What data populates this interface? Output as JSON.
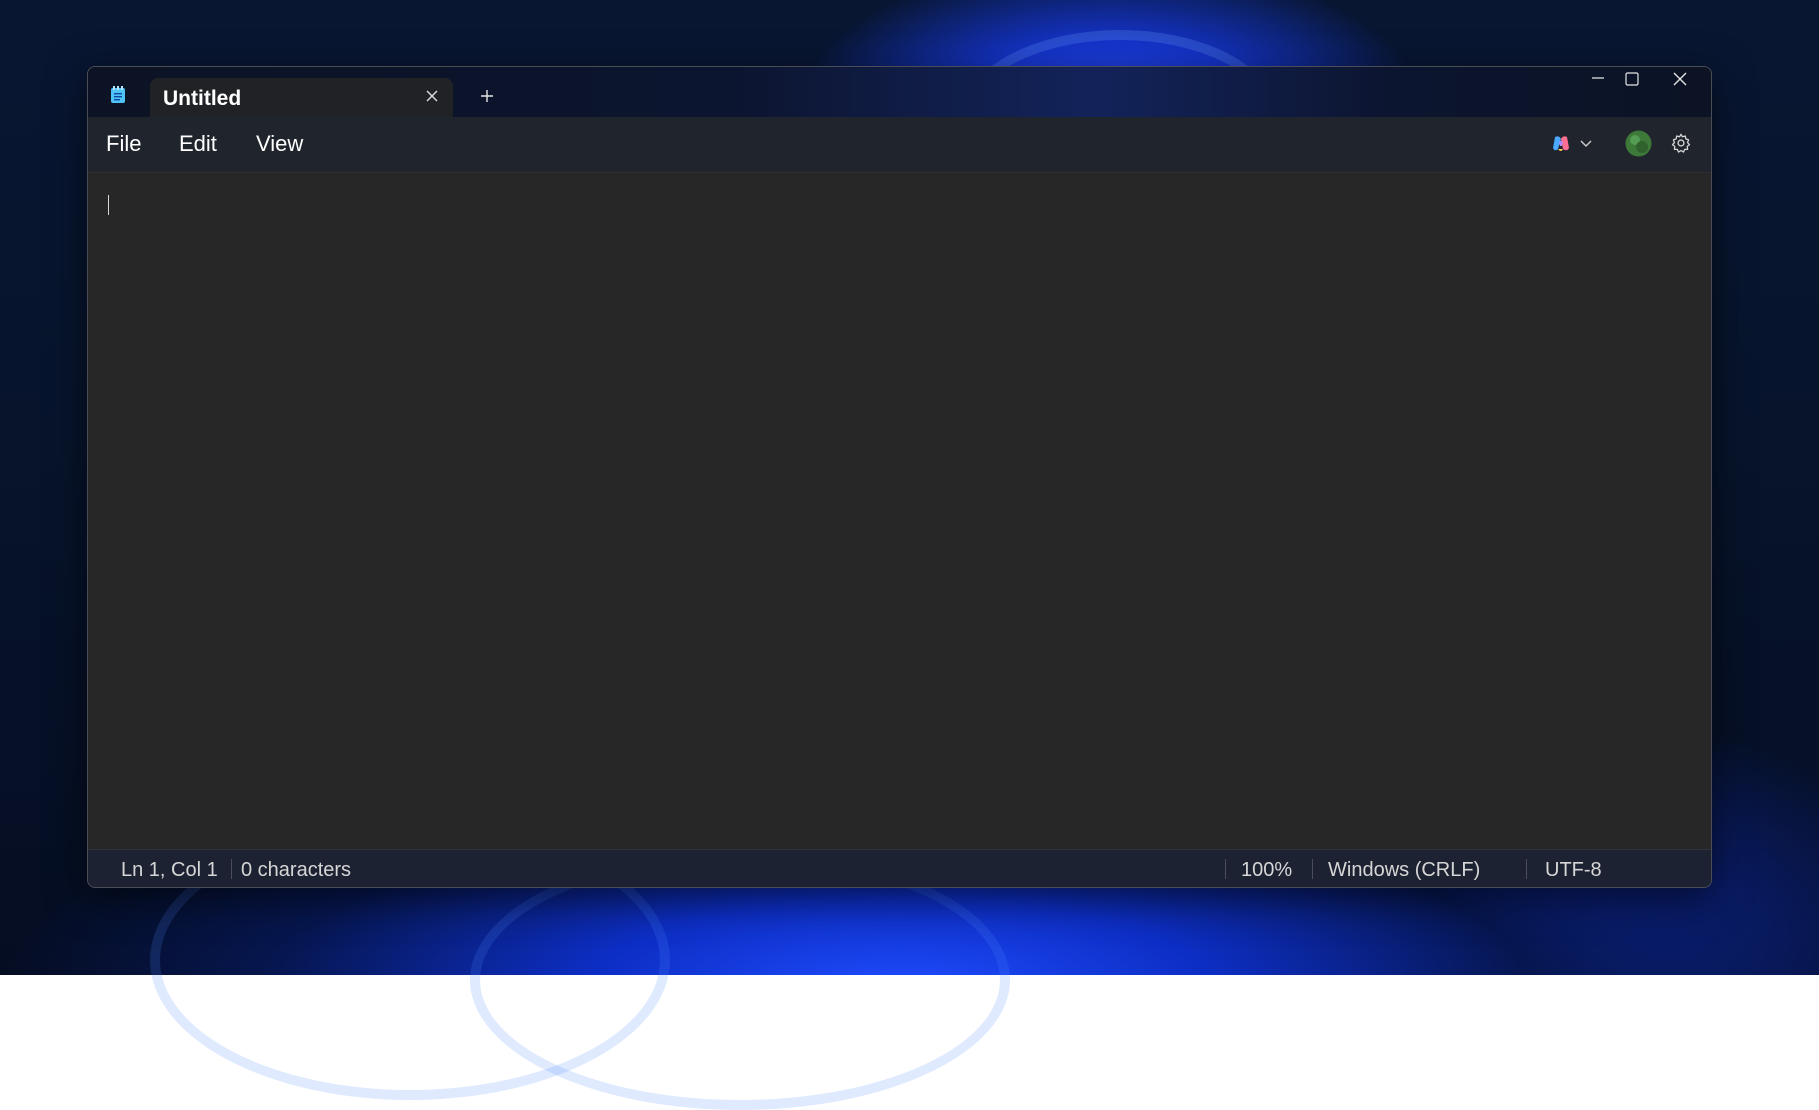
{
  "window": {
    "tab_title": "Untitled",
    "controls": [
      "minimize-icon",
      "maximize-icon",
      "close-icon"
    ]
  },
  "menu": {
    "file": "File",
    "edit": "Edit",
    "view": "View"
  },
  "toolbar": {
    "icons": [
      "copilot-icon",
      "chevron-down-icon",
      "avatar",
      "gear-icon"
    ]
  },
  "editor": {
    "content": ""
  },
  "status": {
    "position": "Ln 1, Col 1",
    "characters": "0 characters",
    "zoom": "100%",
    "line_ending": "Windows (CRLF)",
    "encoding": "UTF-8"
  },
  "colors": {
    "editor_bg": "#272727",
    "menubar_bg": "#20242c",
    "accent_blue": "#1f4cff"
  }
}
